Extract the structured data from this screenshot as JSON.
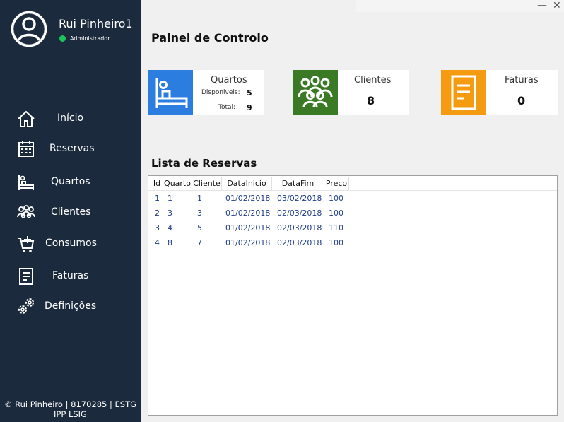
{
  "sidebar": {
    "user_name": "Rui Pinheiro1",
    "role": "Administrador",
    "items": [
      {
        "label": "Início",
        "icon": "home-icon"
      },
      {
        "label": "Reservas",
        "icon": "calendar-icon"
      },
      {
        "label": "Quartos",
        "icon": "bed-icon"
      },
      {
        "label": "Clientes",
        "icon": "users-icon"
      },
      {
        "label": "Consumos",
        "icon": "cart-icon"
      },
      {
        "label": "Faturas",
        "icon": "invoice-icon"
      },
      {
        "label": "Definições",
        "icon": "gears-icon"
      }
    ],
    "footer_line1": "© Rui Pinheiro  |  8170285  |  ESTG",
    "footer_line2": "IPP LSIG"
  },
  "window": {
    "minimize": "—",
    "close": "✕"
  },
  "main": {
    "title": "Painel de Controlo",
    "cards": {
      "quartos": {
        "title": "Quartos",
        "disp_label": "Disponiveis:",
        "disp_value": "5",
        "total_label": "Total:",
        "total_value": "9",
        "color": "#2b7de0"
      },
      "clientes": {
        "title": "Clientes",
        "value": "8",
        "color": "#3a7a25"
      },
      "faturas": {
        "title": "Faturas",
        "value": "0",
        "color": "#f59b12"
      }
    },
    "list_title": "Lista de Reservas",
    "table": {
      "columns": [
        "Id",
        "Quarto",
        "Cliente",
        "DataInicio",
        "DataFim",
        "Preço"
      ],
      "rows": [
        [
          "1",
          "1",
          "1",
          "01/02/2018",
          "03/02/2018",
          "100"
        ],
        [
          "2",
          "3",
          "3",
          "01/02/2018",
          "02/03/2018",
          "100"
        ],
        [
          "3",
          "4",
          "5",
          "01/02/2018",
          "02/03/2018",
          "110"
        ],
        [
          "4",
          "8",
          "7",
          "01/02/2018",
          "02/03/2018",
          "100"
        ]
      ]
    }
  }
}
